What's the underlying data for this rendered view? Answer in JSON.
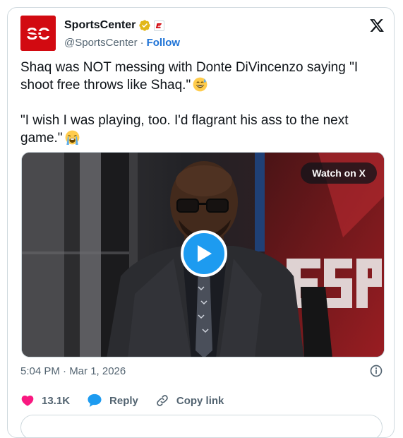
{
  "account": {
    "display_name": "SportsCenter",
    "handle": "@SportsCenter",
    "separator": "·",
    "follow_label": "Follow",
    "avatar_text": "SC"
  },
  "tweet": {
    "paragraph_1": "Shaq was NOT messing with Donte DiVincenzo saying \"I shoot free throws like Shaq.\"",
    "paragraph_1_emoji": "grinning-face-with-sweat",
    "paragraph_2": "\"I wish I was playing, too. I'd flagrant his ass to the next game.\"",
    "paragraph_2_emoji": "loudly-crying-face",
    "timestamp": "5:04 PM · Mar 1, 2026"
  },
  "media": {
    "watch_label": "Watch on X",
    "background_logo": "ESPN"
  },
  "actions": {
    "like_count": "13.1K",
    "reply_label": "Reply",
    "copy_link_label": "Copy link"
  },
  "colors": {
    "accent": "#1d9bf0",
    "like_red": "#f91880",
    "brand_red": "#d20a11",
    "follow_blue": "#1d72d6",
    "muted": "#536471"
  }
}
